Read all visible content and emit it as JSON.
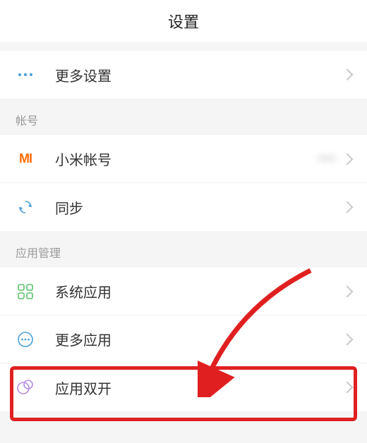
{
  "header": {
    "title": "设置"
  },
  "rows": {
    "more_settings": {
      "label": "更多设置"
    }
  },
  "accounts": {
    "title": "帐号",
    "xiaomi": {
      "label": "小米帐号",
      "value": "••••"
    },
    "sync": {
      "label": "同步"
    }
  },
  "apps": {
    "title": "应用管理",
    "system_apps": {
      "label": "系统应用"
    },
    "more_apps": {
      "label": "更多应用"
    },
    "dual_apps": {
      "label": "应用双开"
    }
  }
}
